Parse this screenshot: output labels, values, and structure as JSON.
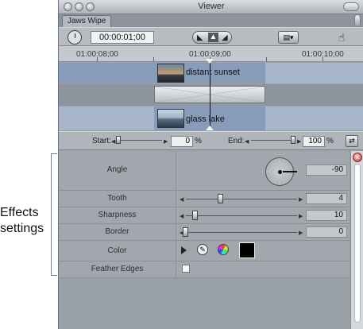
{
  "annotation": {
    "line1": "Effects",
    "line2": "settings"
  },
  "window": {
    "title": "Viewer",
    "tab_label": "Jaws Wipe"
  },
  "toolbar": {
    "timecode": "00:00:01;00",
    "menu_glyph": "▤▾",
    "hand_icon": "hand-icon"
  },
  "ruler": {
    "labels": [
      "01:00:08;00",
      "01:00:09;00",
      "01:00:10;00"
    ]
  },
  "tracks": {
    "clip_a": "distant sunset",
    "clip_b": "glass lake"
  },
  "range": {
    "start_label": "Start:",
    "start_value": "0",
    "start_unit": "%",
    "end_label": "End:",
    "end_value": "100",
    "end_unit": "%"
  },
  "params": {
    "angle": {
      "label": "Angle",
      "value": "-90"
    },
    "tooth": {
      "label": "Tooth",
      "value": "4",
      "level": 0.4
    },
    "sharpness": {
      "label": "Sharpness",
      "value": "10",
      "level": 0.1
    },
    "border": {
      "label": "Border",
      "value": "0",
      "level": 0.0
    },
    "color": {
      "label": "Color",
      "swatch": "#000000"
    },
    "feather": {
      "label": "Feather Edges",
      "checked": false
    }
  },
  "colors": {
    "track_blue": "#879cb8",
    "panel_gray": "#a2a7ad",
    "close_red": "#c43b3b"
  }
}
